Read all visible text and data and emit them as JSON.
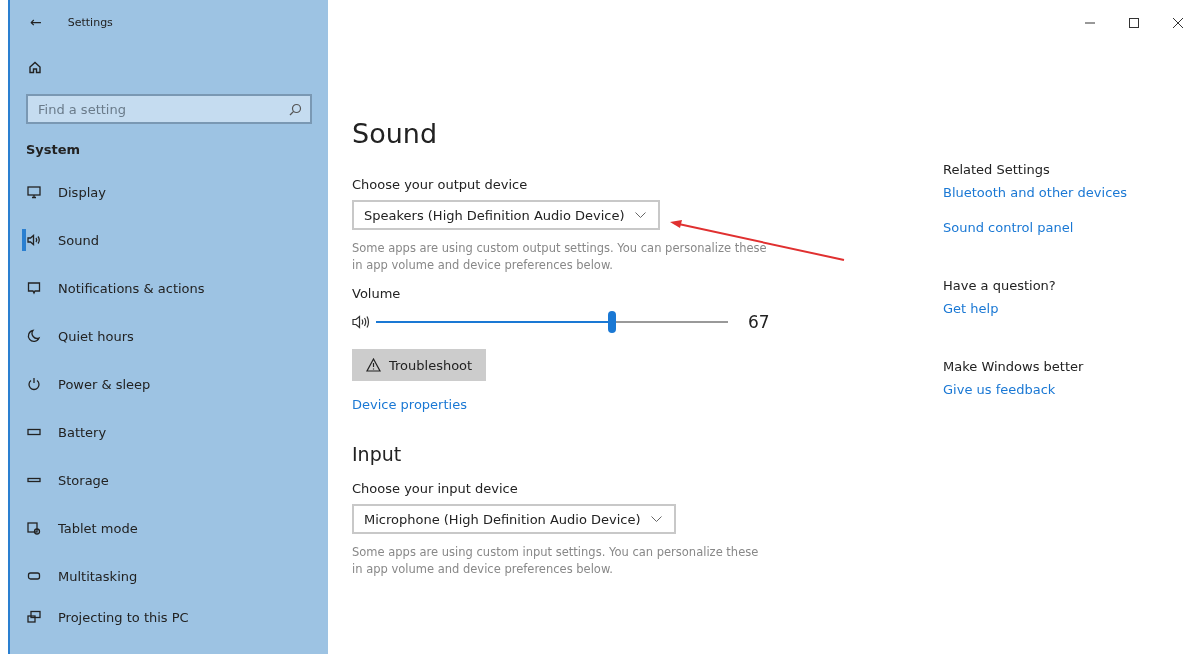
{
  "sidebar": {
    "back": "←",
    "title": "Settings",
    "search": {
      "placeholder": "Find a setting"
    },
    "section": "System",
    "items": [
      {
        "label": "Display",
        "selected": false
      },
      {
        "label": "Sound",
        "selected": true
      },
      {
        "label": "Notifications & actions",
        "selected": false
      },
      {
        "label": "Quiet hours",
        "selected": false
      },
      {
        "label": "Power & sleep",
        "selected": false
      },
      {
        "label": "Battery",
        "selected": false
      },
      {
        "label": "Storage",
        "selected": false
      },
      {
        "label": "Tablet mode",
        "selected": false
      },
      {
        "label": "Multitasking",
        "selected": false
      },
      {
        "label": "Projecting to this PC",
        "selected": false
      }
    ]
  },
  "main": {
    "title": "Sound",
    "output": {
      "label": "Choose your output device",
      "value": "Speakers (High Definition Audio Device)",
      "note": "Some apps are using custom output settings. You can personalize these in app volume and device preferences below."
    },
    "volume": {
      "label": "Volume",
      "level": 0.67,
      "reading": "67"
    },
    "troubleshoot": "Troubleshoot",
    "device_properties": "Device properties",
    "input_title": "Input",
    "input": {
      "label": "Choose your input device",
      "value": "Microphone (High Definition Audio Device)",
      "note": "Some apps are using custom input settings. You can personalize these in app volume and device preferences below."
    }
  },
  "related": [
    {
      "heading": "Related Settings",
      "links": [
        "Bluetooth and other devices",
        "Sound control panel"
      ]
    },
    {
      "heading": "Have a question?",
      "links": [
        "Get help"
      ]
    },
    {
      "heading": "Make Windows better",
      "links": [
        "Give us feedback"
      ]
    }
  ]
}
